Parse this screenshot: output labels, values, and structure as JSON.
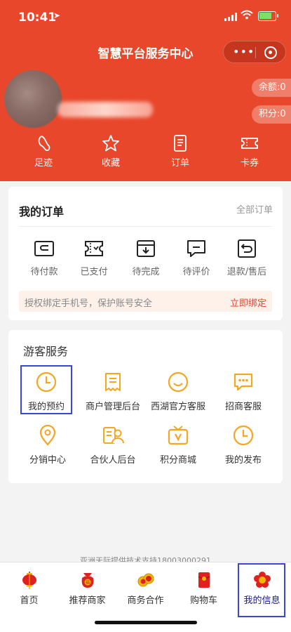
{
  "status_bar": {
    "time": "10:41"
  },
  "header": {
    "title": "智慧平台服务中心",
    "balance": "余额:0",
    "points": "积分:0",
    "quick_links": [
      {
        "label": "足迹",
        "icon": "footprint-icon"
      },
      {
        "label": "收藏",
        "icon": "star-icon"
      },
      {
        "label": "订单",
        "icon": "order-icon"
      },
      {
        "label": "卡券",
        "icon": "ticket-icon"
      }
    ]
  },
  "orders": {
    "title": "我的订单",
    "all_label": "全部订单",
    "items": [
      {
        "label": "待付款",
        "icon": "wallet-icon"
      },
      {
        "label": "已支付",
        "icon": "paid-ticket-icon"
      },
      {
        "label": "待完成",
        "icon": "download-box-icon"
      },
      {
        "label": "待评价",
        "icon": "comment-icon"
      },
      {
        "label": "退款/售后",
        "icon": "return-icon"
      }
    ],
    "bind_tip": "授权绑定手机号，保护账号安全",
    "bind_action": "立即绑定"
  },
  "services": {
    "title": "游客服务",
    "items": [
      {
        "label": "我的预约",
        "icon": "clock-icon"
      },
      {
        "label": "商户管理后台",
        "icon": "receipt-icon"
      },
      {
        "label": "西湖官方客服",
        "icon": "smile-icon"
      },
      {
        "label": "招商客服",
        "icon": "chat-dots-icon"
      },
      {
        "label": "分销中心",
        "icon": "location-icon"
      },
      {
        "label": "合伙人后台",
        "icon": "partner-icon"
      },
      {
        "label": "积分商城",
        "icon": "tv-shop-icon"
      },
      {
        "label": "我的发布",
        "icon": "clock-icon"
      }
    ]
  },
  "footer_text": "亚洲天际提供技术支持18003000291",
  "tabbar": [
    {
      "label": "首页",
      "icon": "lantern-icon"
    },
    {
      "label": "推荐商家",
      "icon": "lucky-bag-icon"
    },
    {
      "label": "商务合作",
      "icon": "coins-icon"
    },
    {
      "label": "购物车",
      "icon": "red-envelope-icon"
    },
    {
      "label": "我的信息",
      "icon": "flower-icon",
      "active": true
    }
  ],
  "colors": {
    "brand": "#e8472b",
    "accent": "#f5a623",
    "highlight": "#3b46d8"
  }
}
